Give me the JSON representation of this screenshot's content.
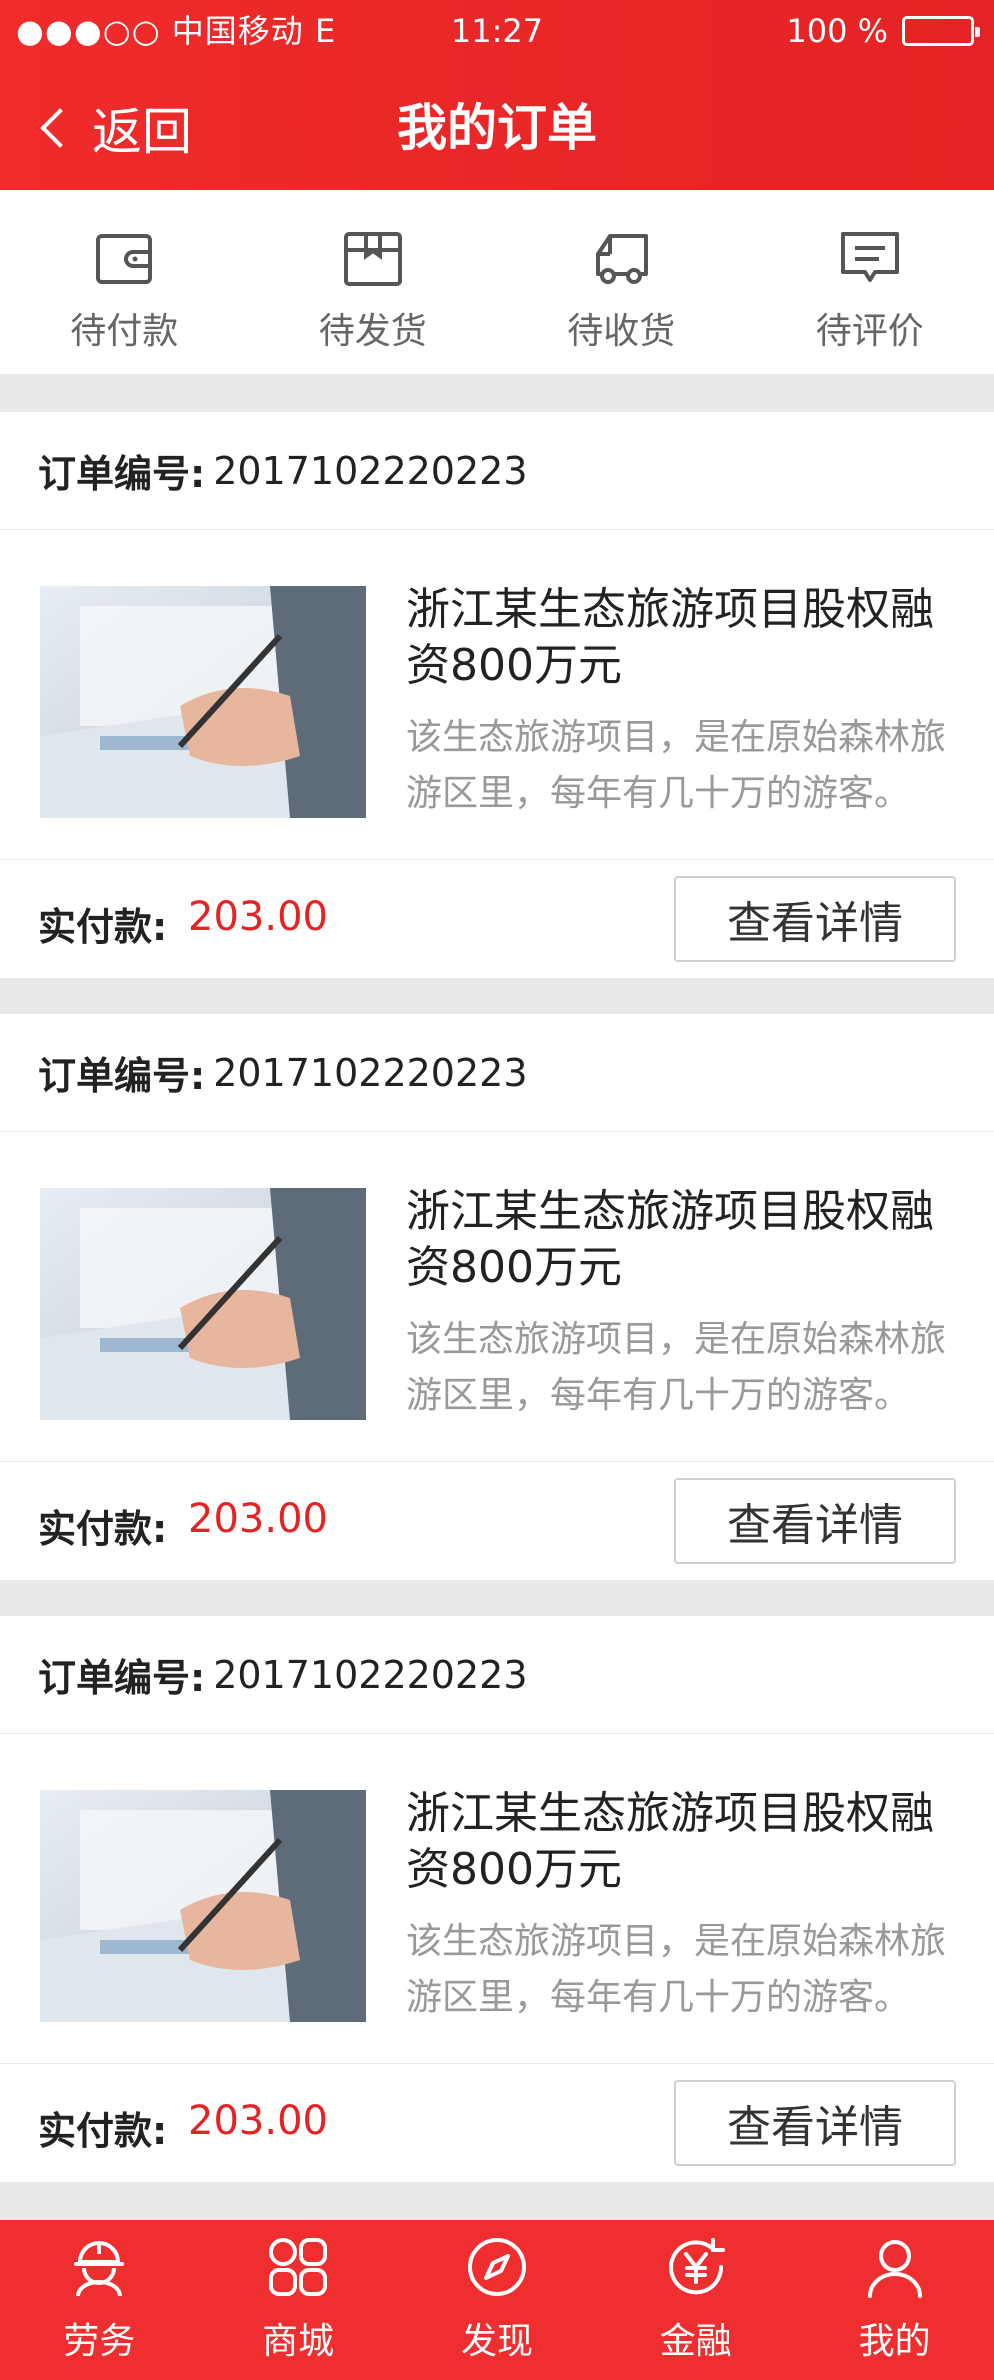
{
  "status_bar": {
    "carrier": "●●●○○ 中国移动 E",
    "time": "11:27",
    "battery": "100 %"
  },
  "nav": {
    "back_label": "返回",
    "title": "我的订单"
  },
  "tabs": [
    {
      "label": "待付款",
      "icon": "wallet-icon"
    },
    {
      "label": "待发货",
      "icon": "package-icon"
    },
    {
      "label": "待收货",
      "icon": "truck-icon"
    },
    {
      "label": "待评价",
      "icon": "comment-icon"
    }
  ],
  "orders": [
    {
      "order_no_label": "订单编号:",
      "order_no": "2017102220223",
      "title": "浙江某生态旅游项目股权融资800万元",
      "desc": "该生态旅游项目，是在原始森林旅游区里，每年有几十万的游客。",
      "paid_label": "实付款:",
      "paid_amount": "203.00",
      "detail_button": "查看详情"
    },
    {
      "order_no_label": "订单编号:",
      "order_no": "2017102220223",
      "title": "浙江某生态旅游项目股权融资800万元",
      "desc": "该生态旅游项目，是在原始森林旅游区里，每年有几十万的游客。",
      "paid_label": "实付款:",
      "paid_amount": "203.00",
      "detail_button": "查看详情"
    },
    {
      "order_no_label": "订单编号:",
      "order_no": "2017102220223",
      "title": "浙江某生态旅游项目股权融资800万元",
      "desc": "该生态旅游项目，是在原始森林旅游区里，每年有几十万的游客。",
      "paid_label": "实付款:",
      "paid_amount": "203.00",
      "detail_button": "查看详情"
    }
  ],
  "bottom_nav": [
    {
      "label": "劳务",
      "icon": "worker-helmet-icon"
    },
    {
      "label": "商城",
      "icon": "grid-icon"
    },
    {
      "label": "发现",
      "icon": "compass-icon"
    },
    {
      "label": "金融",
      "icon": "yuan-icon"
    },
    {
      "label": "我的",
      "icon": "user-icon"
    }
  ],
  "colors": {
    "brand_red": "#e52324",
    "price_red": "#e52324",
    "page_bg": "#e9e9e9"
  }
}
